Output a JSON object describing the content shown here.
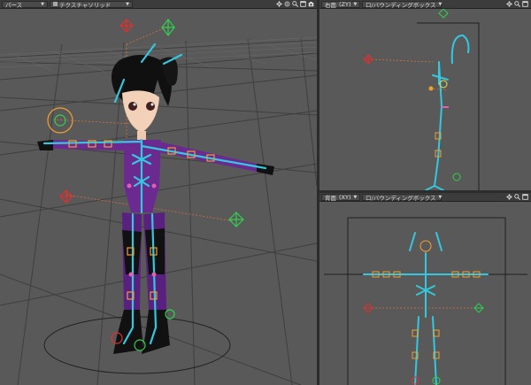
{
  "viewports": {
    "perspective": {
      "view_mode": "パース",
      "shading_mode": "テクスチャソリッド"
    },
    "right_view": {
      "view_mode": "右面",
      "axis": "(ZY)",
      "shading_mode": "ロ/バウンディングボックス"
    },
    "front_view": {
      "view_mode": "背面",
      "axis": "(XY)",
      "shading_mode": "ロ/バウンディングボックス"
    }
  },
  "icons": [
    "move-icon",
    "rotate-icon",
    "zoom-icon",
    "maximize-icon",
    "camera-icon"
  ],
  "colors": {
    "viewport_bg": "#595959",
    "toolbar_bg": "#3c3c3c",
    "bone": "#33c8e0",
    "null_red": "#e03030",
    "null_green": "#30d050",
    "selection_orange": "#f0a030",
    "outfit_purple": "#6a2a90"
  }
}
